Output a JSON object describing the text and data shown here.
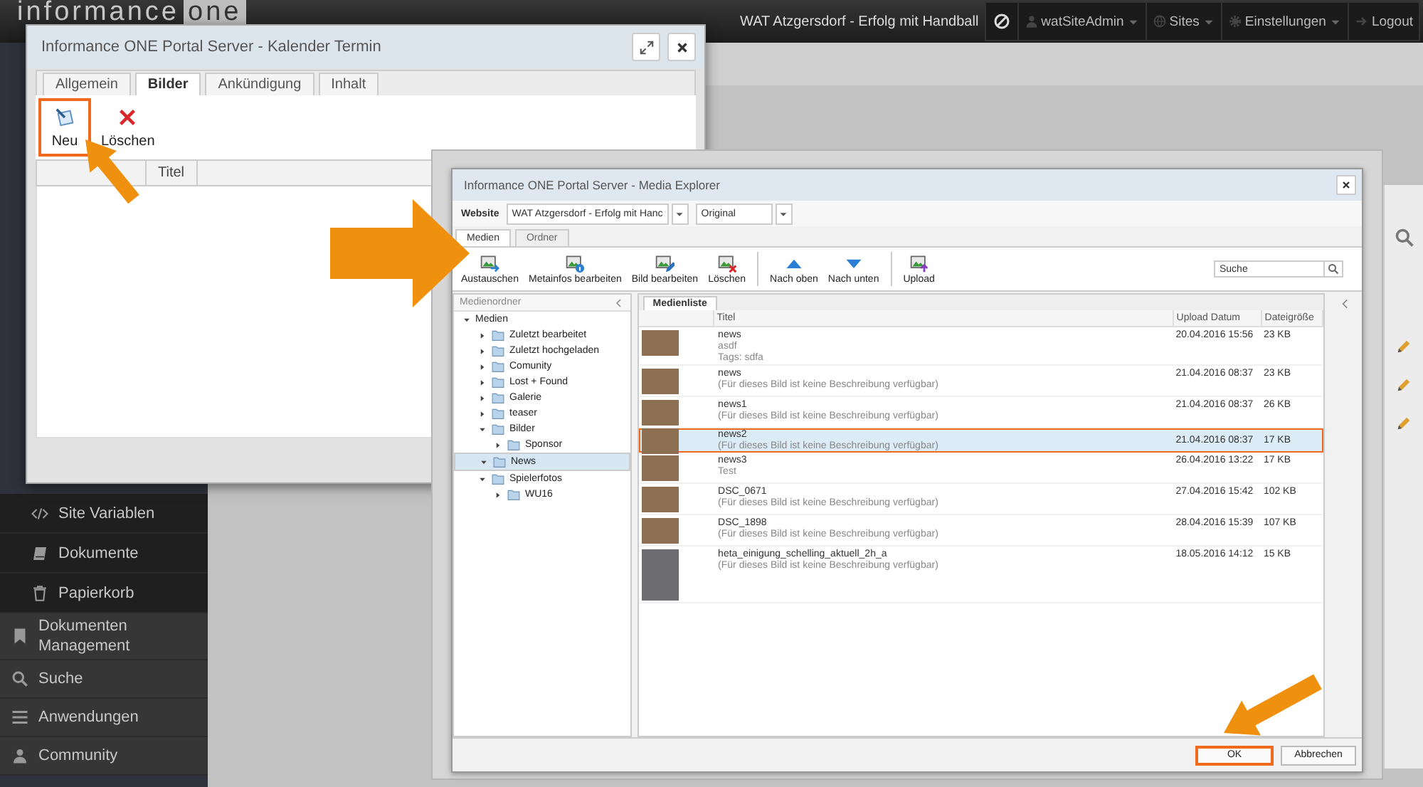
{
  "topbar": {
    "logo": "informance",
    "logo_badge": "one",
    "site_title": "WAT Atzgersdorf - Erfolg mit Handball",
    "menu": [
      {
        "label": "watSiteAdmin",
        "dropdown": true
      },
      {
        "label": "Sites",
        "dropdown": true
      },
      {
        "label": "Einstellungen",
        "dropdown": true
      },
      {
        "label": "Logout",
        "dropdown": false
      }
    ]
  },
  "sidebar": {
    "items": [
      {
        "kind": "subitem",
        "label": "Site Variablen"
      },
      {
        "kind": "subitem",
        "label": "Dokumente"
      },
      {
        "kind": "subitem",
        "label": "Papierkorb"
      },
      {
        "kind": "item",
        "label": "Dokumenten Management"
      },
      {
        "kind": "item",
        "label": "Suche"
      },
      {
        "kind": "item",
        "label": "Anwendungen"
      },
      {
        "kind": "item",
        "label": "Community"
      }
    ]
  },
  "kalender_dialog": {
    "title": "Informance ONE Portal Server - Kalender Termin",
    "tabs": [
      {
        "label": "Allgemein",
        "selected": false
      },
      {
        "label": "Bilder",
        "selected": true
      },
      {
        "label": "Ankündigung",
        "selected": false
      },
      {
        "label": "Inhalt",
        "selected": false
      }
    ],
    "toolbar": [
      {
        "label": "Neu",
        "highlighted": true
      },
      {
        "label": "Löschen",
        "highlighted": false
      }
    ],
    "columns": [
      "Titel"
    ]
  },
  "media_explorer": {
    "title": "Informance ONE Portal Server - Media Explorer",
    "website_label": "Website",
    "website_value": "WAT Atzgersdorf - Erfolg mit Hanc",
    "variant_value": "Original",
    "tabs": [
      {
        "label": "Medien",
        "selected": true
      },
      {
        "label": "Ordner",
        "selected": false
      }
    ],
    "toolbar_groups": [
      {
        "items": [
          {
            "label": "Austauschen"
          },
          {
            "label": "Metainfos bearbeiten"
          },
          {
            "label": "Bild bearbeiten"
          },
          {
            "label": "Löschen"
          }
        ]
      },
      {
        "items": [
          {
            "label": "Nach oben"
          },
          {
            "label": "Nach unten"
          }
        ]
      },
      {
        "items": [
          {
            "label": "Upload"
          }
        ]
      }
    ],
    "search": {
      "placeholder": "Suche"
    },
    "folders": {
      "title": "Medienordner",
      "tree": [
        {
          "label": "Medien",
          "expanded": true,
          "selected": false,
          "children": [
            {
              "label": "Zuletzt bearbeitet",
              "expanded": false,
              "selected": false
            },
            {
              "label": "Zuletzt hochgeladen",
              "expanded": false,
              "selected": false
            },
            {
              "label": "Comunity",
              "expanded": false,
              "selected": false
            },
            {
              "label": "Lost + Found",
              "expanded": false,
              "selected": false
            },
            {
              "label": "Galerie",
              "expanded": false,
              "selected": false
            },
            {
              "label": "teaser",
              "expanded": false,
              "selected": false
            },
            {
              "label": "Bilder",
              "expanded": true,
              "selected": false,
              "children": [
                {
                  "label": "Sponsor",
                  "expanded": false,
                  "selected": false
                }
              ]
            },
            {
              "label": "News",
              "expanded": true,
              "selected": true
            },
            {
              "label": "Spielerfotos",
              "expanded": true,
              "selected": false,
              "children": [
                {
                  "label": "WU16",
                  "expanded": false,
                  "selected": false
                }
              ]
            }
          ]
        }
      ]
    },
    "list": {
      "tab": "Medienliste",
      "columns": [
        "Titel",
        "Upload Datum",
        "Dateigröße"
      ],
      "rows": [
        {
          "title": "news",
          "lines": [
            "asdf",
            "Tags: sdfa"
          ],
          "date": "20.04.2016 15:56",
          "size": "23 KB",
          "selected": false,
          "highlighted": false
        },
        {
          "title": "news",
          "lines": [
            "(Für dieses Bild ist keine Beschreibung verfügbar)"
          ],
          "date": "21.04.2016 08:37",
          "size": "23 KB",
          "selected": false,
          "highlighted": false
        },
        {
          "title": "news1",
          "lines": [
            "(Für dieses Bild ist keine Beschreibung verfügbar)"
          ],
          "date": "21.04.2016 08:37",
          "size": "26 KB",
          "selected": false,
          "highlighted": false
        },
        {
          "title": "news2",
          "lines": [
            "(Für dieses Bild ist keine Beschreibung verfügbar)"
          ],
          "date": "21.04.2016 08:37",
          "size": "17 KB",
          "selected": true,
          "highlighted": true
        },
        {
          "title": "news3",
          "lines": [
            "Test"
          ],
          "date": "26.04.2016 13:22",
          "size": "17 KB",
          "selected": false,
          "highlighted": false
        },
        {
          "title": "DSC_0671",
          "lines": [
            "(Für dieses Bild ist keine Beschreibung verfügbar)"
          ],
          "date": "27.04.2016 15:42",
          "size": "102 KB",
          "selected": false,
          "highlighted": false
        },
        {
          "title": "DSC_1898",
          "lines": [
            "(Für dieses Bild ist keine Beschreibung verfügbar)"
          ],
          "date": "28.04.2016 15:39",
          "size": "107 KB",
          "selected": false,
          "highlighted": false
        },
        {
          "title": "heta_einigung_schelling_aktuell_2h_a",
          "lines": [
            "(Für dieses Bild ist keine Beschreibung verfügbar)"
          ],
          "date": "18.05.2016 14:12",
          "size": "15 KB",
          "selected": false,
          "highlighted": false
        }
      ]
    },
    "buttons": [
      {
        "label": "OK",
        "highlighted": true
      },
      {
        "label": "Abbrechen",
        "highlighted": false
      }
    ]
  }
}
